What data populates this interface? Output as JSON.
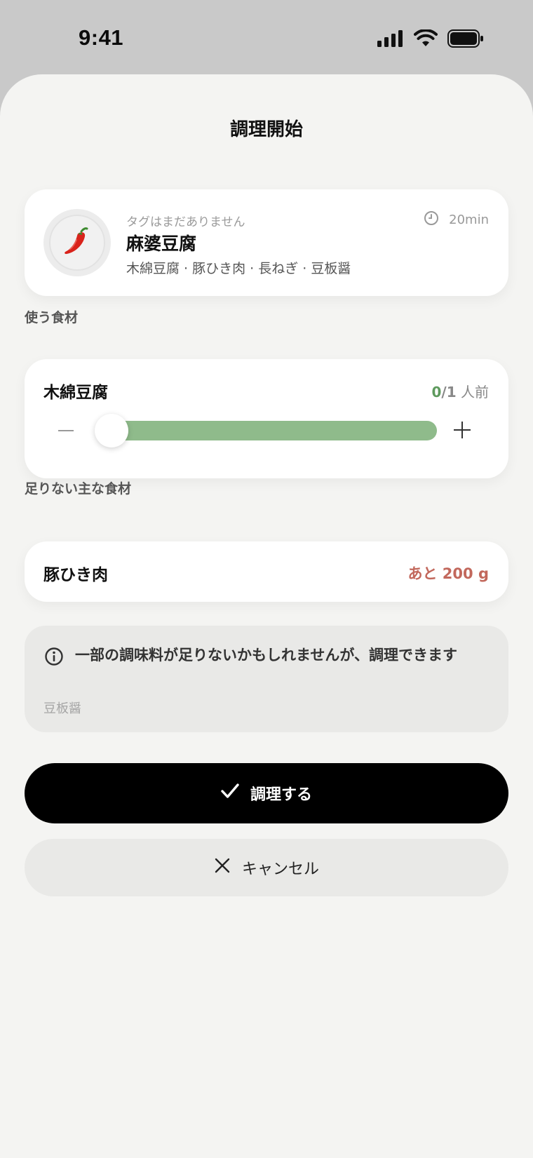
{
  "status_bar": {
    "time": "9:41",
    "icons": [
      "cellular-signal-icon",
      "wifi-icon",
      "battery-icon"
    ]
  },
  "sheet": {
    "title": "調理開始"
  },
  "recipe": {
    "tags": "タグはまだありません",
    "name": "麻婆豆腐",
    "ingredients": "木綿豆腐 · 豚ひき肉 · 長ねぎ · 豆板醤",
    "time": "20min",
    "icon": "chili-pepper-icon",
    "emoji": "🌶️"
  },
  "sections": {
    "use_ingredients": "使う食材",
    "missing_main": "足りない主な食材"
  },
  "ingredient_slider": {
    "name": "木綿豆腐",
    "current": "0",
    "separator": "/",
    "total": "1",
    "unit": " 人前",
    "level": 0
  },
  "missing": {
    "name": "豚ひき肉",
    "amount": "あと 200 g"
  },
  "info": {
    "message": "一部の調味料が足りないかもしれませんが、調理できます",
    "items": "豆板醤"
  },
  "buttons": {
    "cook": "調理する",
    "cancel": "キャンセル"
  },
  "colors": {
    "accent_green": "#8fbb8b",
    "servings_green": "#5e9a5d",
    "missing_red": "#c2685c",
    "primary_button": "#000000",
    "sheet_bg": "#f4f4f2"
  }
}
